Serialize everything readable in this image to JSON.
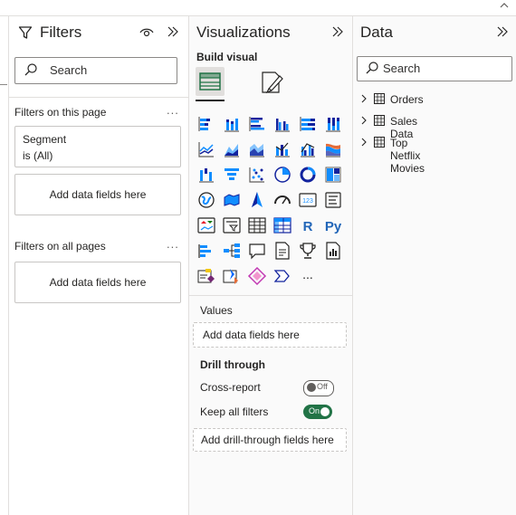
{
  "top": {
    "collapse_icon": "chevron-up-icon"
  },
  "filters": {
    "title": "Filters",
    "search_placeholder": "Search",
    "on_this_page_label": "Filters on this page",
    "more_label": "...",
    "card": {
      "field": "Segment",
      "condition": "is (All)"
    },
    "add_fields_label": "Add data fields here",
    "on_all_pages_label": "Filters on all pages",
    "add_fields_label_all": "Add data fields here"
  },
  "visualizations": {
    "title": "Visualizations",
    "build_visual_label": "Build visual",
    "more_visuals": "...",
    "values_label": "Values",
    "values_placeholder": "Add data fields here",
    "drill_through_label": "Drill through",
    "cross_report_label": "Cross-report",
    "cross_report_state": "Off",
    "keep_all_filters_label": "Keep all filters",
    "keep_all_filters_state": "On",
    "drill_placeholder": "Add drill-through fields here",
    "icons": [
      "stacked-bar-chart-icon",
      "stacked-column-chart-icon",
      "clustered-bar-chart-icon",
      "clustered-column-chart-icon",
      "100-percent-stacked-bar-chart-icon",
      "100-percent-stacked-column-chart-icon",
      "line-chart-icon",
      "area-chart-icon",
      "stacked-area-chart-icon",
      "line-and-stacked-column-chart-icon",
      "line-and-clustered-column-chart-icon",
      "ribbon-chart-icon",
      "waterfall-chart-icon",
      "funnel-chart-icon",
      "scatter-chart-icon",
      "pie-chart-icon",
      "donut-chart-icon",
      "treemap-icon",
      "map-icon",
      "filled-map-icon",
      "azure-map-icon",
      "gauge-icon",
      "card-icon",
      "multi-row-card-icon",
      "kpi-icon",
      "slicer-icon",
      "table-icon",
      "matrix-icon",
      "r-script-visual-icon",
      "python-visual-icon",
      "key-influencers-icon",
      "decomposition-tree-icon",
      "qa-icon",
      "smart-narrative-icon",
      "metrics-icon",
      "paginated-report-icon",
      "power-apps-icon",
      "power-automate-icon",
      "arcgis-icon",
      "more-visuals-icon"
    ]
  },
  "data": {
    "title": "Data",
    "search_placeholder": "Search",
    "tables": [
      "Orders",
      "Sales Data",
      "Top Netflix Movies"
    ]
  },
  "colors": {
    "accent_teal": "#118dff",
    "on_green": "#217346",
    "pane_border": "#e1dfdd"
  }
}
